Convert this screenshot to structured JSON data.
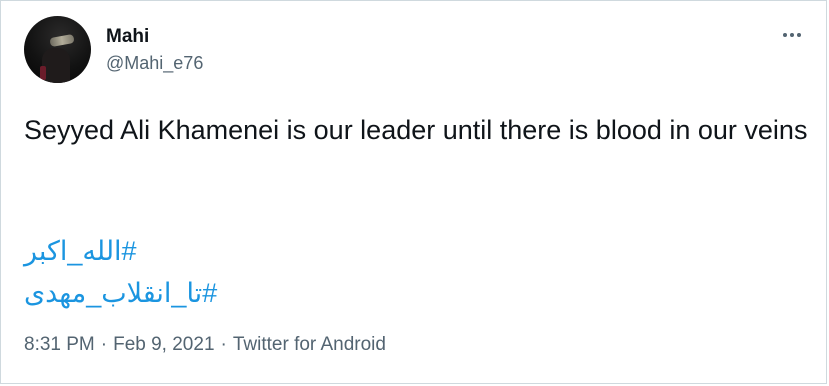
{
  "user": {
    "name": "Mahi",
    "handle": "@Mahi_e76"
  },
  "tweet": {
    "text": "Seyyed Ali Khamenei is our leader until there is blood in our veins",
    "hashtags": [
      "#الله_اکبر",
      "#تا_انقلاب_مهدی"
    ],
    "time": "8:31 PM",
    "date": "Feb 9, 2021",
    "separator": "·",
    "source": "Twitter for Android"
  },
  "icons": {
    "more": "more-options-icon"
  },
  "colors": {
    "link": "#1b95e0",
    "text": "#0f1419",
    "muted": "#536471",
    "border": "#cfd9de"
  }
}
